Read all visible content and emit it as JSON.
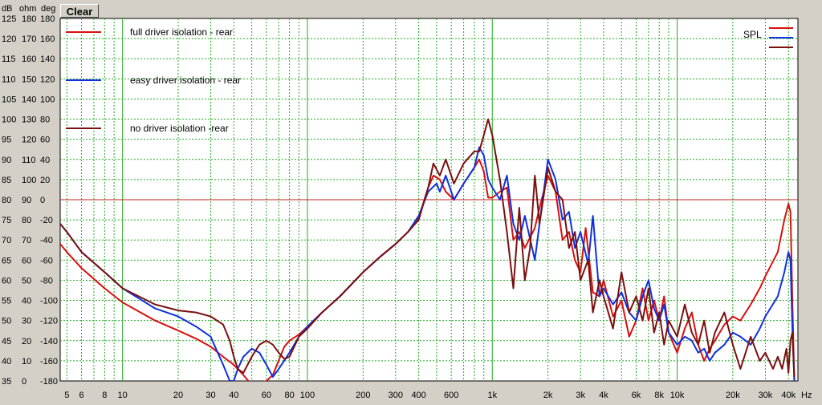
{
  "toolbar": {
    "clear_label": "Clear"
  },
  "chart_data": {
    "type": "line",
    "title": "",
    "xlabel": "Hz",
    "x_scale": "log",
    "xlim": [
      4.6,
      45000
    ],
    "x_tick_labels": [
      {
        "v": 5,
        "t": "5"
      },
      {
        "v": 6,
        "t": "6"
      },
      {
        "v": 8,
        "t": "8"
      },
      {
        "v": 10,
        "t": "10"
      },
      {
        "v": 20,
        "t": "20"
      },
      {
        "v": 30,
        "t": "30"
      },
      {
        "v": 40,
        "t": "40"
      },
      {
        "v": 60,
        "t": "60"
      },
      {
        "v": 80,
        "t": "80"
      },
      {
        "v": 100,
        "t": "100"
      },
      {
        "v": 200,
        "t": "200"
      },
      {
        "v": 300,
        "t": "300"
      },
      {
        "v": 400,
        "t": "400"
      },
      {
        "v": 600,
        "t": "600"
      },
      {
        "v": 1000,
        "t": "1k"
      },
      {
        "v": 2000,
        "t": "2k"
      },
      {
        "v": 3000,
        "t": "3k"
      },
      {
        "v": 4000,
        "t": "4k"
      },
      {
        "v": 6000,
        "t": "6k"
      },
      {
        "v": 8000,
        "t": "8k"
      },
      {
        "v": 10000,
        "t": "10k"
      },
      {
        "v": 20000,
        "t": "20k"
      },
      {
        "v": 30000,
        "t": "30k"
      },
      {
        "v": 40000,
        "t": "40k"
      }
    ],
    "y_axes": {
      "header": [
        "dB",
        "ohm",
        "deg"
      ],
      "db": [
        "125",
        "120",
        "115",
        "110",
        "105",
        "100",
        "95",
        "90",
        "85",
        "80",
        "75",
        "70",
        "65",
        "60",
        "55",
        "50",
        "45",
        "40",
        "35"
      ],
      "ohm": [
        "180",
        "170",
        "160",
        "150",
        "140",
        "130",
        "120",
        "110",
        "100",
        "90",
        "80",
        "70",
        "60",
        "50",
        "40",
        "30",
        "20",
        "10",
        "0"
      ],
      "deg": [
        "180",
        "160",
        "140",
        "120",
        "100",
        "80",
        "60",
        "40",
        "20",
        "0",
        "-20",
        "-40",
        "-60",
        "-80",
        "-100",
        "-120",
        "-140",
        "-160",
        "-180"
      ]
    },
    "ylabel": "dB",
    "ylim": [
      35,
      125
    ],
    "reference_line": 80,
    "grid": true,
    "legend_position": "top-left",
    "series_tag": "SPL",
    "series": [
      {
        "name": "full driver isolation - rear",
        "color": "#d81010",
        "points": [
          [
            4.6,
            69
          ],
          [
            5,
            67
          ],
          [
            6,
            63
          ],
          [
            8,
            58
          ],
          [
            10,
            54.5
          ],
          [
            15,
            50
          ],
          [
            20,
            47.5
          ],
          [
            25,
            45.5
          ],
          [
            30,
            43.5
          ],
          [
            35,
            41
          ],
          [
            40,
            39
          ],
          [
            45,
            36.5
          ],
          [
            50,
            34
          ],
          [
            60,
            35
          ],
          [
            65,
            36.5
          ],
          [
            75,
            43.5
          ],
          [
            80,
            45
          ],
          [
            90,
            46.5
          ],
          [
            100,
            48.5
          ],
          [
            120,
            52
          ],
          [
            150,
            56
          ],
          [
            200,
            62
          ],
          [
            250,
            66
          ],
          [
            300,
            69
          ],
          [
            350,
            72
          ],
          [
            400,
            75.5
          ],
          [
            450,
            83
          ],
          [
            480,
            86
          ],
          [
            520,
            85
          ],
          [
            560,
            82
          ],
          [
            620,
            80
          ],
          [
            700,
            84
          ],
          [
            800,
            88
          ],
          [
            850,
            90
          ],
          [
            900,
            87
          ],
          [
            950,
            80.5
          ],
          [
            1000,
            80.5
          ],
          [
            1100,
            82
          ],
          [
            1200,
            83
          ],
          [
            1300,
            70
          ],
          [
            1400,
            72
          ],
          [
            1500,
            68
          ],
          [
            1700,
            73
          ],
          [
            1800,
            78
          ],
          [
            2000,
            86
          ],
          [
            2200,
            82
          ],
          [
            2400,
            70
          ],
          [
            2600,
            72
          ],
          [
            2800,
            65
          ],
          [
            3000,
            62
          ],
          [
            3200,
            73
          ],
          [
            3500,
            57
          ],
          [
            3800,
            56
          ],
          [
            4000,
            60
          ],
          [
            4500,
            51
          ],
          [
            5000,
            55
          ],
          [
            5500,
            46
          ],
          [
            6000,
            50
          ],
          [
            6500,
            58
          ],
          [
            7000,
            50
          ],
          [
            7500,
            55
          ],
          [
            8000,
            50
          ],
          [
            8500,
            56
          ],
          [
            9000,
            47
          ],
          [
            10000,
            42
          ],
          [
            11000,
            48
          ],
          [
            12000,
            52
          ],
          [
            13000,
            44
          ],
          [
            14000,
            40
          ],
          [
            15000,
            43
          ],
          [
            16000,
            45
          ],
          [
            18000,
            49
          ],
          [
            20000,
            51
          ],
          [
            22000,
            50
          ],
          [
            25000,
            54
          ],
          [
            28000,
            58
          ],
          [
            30000,
            61
          ],
          [
            35000,
            67
          ],
          [
            38000,
            75
          ],
          [
            40000,
            79
          ],
          [
            41000,
            77
          ],
          [
            42000,
            55
          ],
          [
            43000,
            35
          ]
        ]
      },
      {
        "name": "easy driver isolation - rear",
        "color": "#1030e0",
        "points": [
          [
            4.6,
            74
          ],
          [
            5,
            72
          ],
          [
            6,
            67
          ],
          [
            8,
            62
          ],
          [
            10,
            58
          ],
          [
            15,
            53
          ],
          [
            20,
            51
          ],
          [
            25,
            48.5
          ],
          [
            30,
            46
          ],
          [
            32,
            43
          ],
          [
            35,
            39
          ],
          [
            38,
            35
          ],
          [
            40,
            35
          ],
          [
            42,
            38
          ],
          [
            45,
            41
          ],
          [
            50,
            43
          ],
          [
            55,
            42
          ],
          [
            60,
            39
          ],
          [
            65,
            36
          ],
          [
            70,
            38
          ],
          [
            80,
            42
          ],
          [
            90,
            46
          ],
          [
            100,
            48.5
          ],
          [
            120,
            52
          ],
          [
            150,
            56
          ],
          [
            200,
            62
          ],
          [
            250,
            66
          ],
          [
            300,
            69
          ],
          [
            350,
            72
          ],
          [
            400,
            76
          ],
          [
            450,
            82
          ],
          [
            500,
            84
          ],
          [
            520,
            82
          ],
          [
            560,
            86
          ],
          [
            620,
            80
          ],
          [
            700,
            84
          ],
          [
            800,
            88
          ],
          [
            850,
            93
          ],
          [
            900,
            91
          ],
          [
            950,
            85
          ],
          [
            1000,
            83
          ],
          [
            1100,
            80
          ],
          [
            1200,
            86
          ],
          [
            1300,
            74
          ],
          [
            1400,
            70
          ],
          [
            1500,
            76
          ],
          [
            1700,
            65
          ],
          [
            1800,
            74
          ],
          [
            2000,
            90
          ],
          [
            2200,
            85
          ],
          [
            2400,
            75
          ],
          [
            2600,
            77
          ],
          [
            2800,
            68
          ],
          [
            3000,
            72
          ],
          [
            3300,
            64
          ],
          [
            3500,
            76
          ],
          [
            3800,
            56
          ],
          [
            4000,
            58
          ],
          [
            4500,
            54
          ],
          [
            5000,
            57
          ],
          [
            5500,
            52
          ],
          [
            6000,
            50
          ],
          [
            6500,
            56
          ],
          [
            7000,
            60
          ],
          [
            7500,
            53
          ],
          [
            8000,
            50
          ],
          [
            8500,
            54
          ],
          [
            9000,
            47
          ],
          [
            10000,
            44
          ],
          [
            11000,
            46
          ],
          [
            12000,
            45
          ],
          [
            13000,
            42
          ],
          [
            14000,
            43
          ],
          [
            15000,
            40
          ],
          [
            16000,
            42
          ],
          [
            18000,
            44
          ],
          [
            20000,
            47
          ],
          [
            22000,
            46
          ],
          [
            25000,
            44
          ],
          [
            28000,
            48
          ],
          [
            30000,
            51
          ],
          [
            35000,
            56
          ],
          [
            38000,
            62
          ],
          [
            40000,
            67
          ],
          [
            41000,
            65
          ],
          [
            42000,
            48
          ],
          [
            43000,
            35
          ]
        ]
      },
      {
        "name": "no driver isolation -rear",
        "color": "#7a1010",
        "points": [
          [
            4.6,
            74
          ],
          [
            5,
            72
          ],
          [
            6,
            67
          ],
          [
            8,
            62
          ],
          [
            10,
            58
          ],
          [
            15,
            54
          ],
          [
            20,
            52.5
          ],
          [
            25,
            52
          ],
          [
            30,
            51
          ],
          [
            35,
            49
          ],
          [
            38,
            45
          ],
          [
            40,
            41
          ],
          [
            42,
            38
          ],
          [
            45,
            37
          ],
          [
            50,
            41
          ],
          [
            55,
            44
          ],
          [
            60,
            45
          ],
          [
            65,
            44
          ],
          [
            70,
            42
          ],
          [
            75,
            40.5
          ],
          [
            80,
            41
          ],
          [
            90,
            46
          ],
          [
            100,
            48
          ],
          [
            120,
            52
          ],
          [
            150,
            56
          ],
          [
            200,
            62
          ],
          [
            250,
            66
          ],
          [
            300,
            69
          ],
          [
            350,
            72
          ],
          [
            400,
            75
          ],
          [
            450,
            83
          ],
          [
            480,
            89
          ],
          [
            520,
            86
          ],
          [
            560,
            90
          ],
          [
            620,
            84
          ],
          [
            700,
            89
          ],
          [
            800,
            92
          ],
          [
            850,
            92
          ],
          [
            900,
            96
          ],
          [
            950,
            100
          ],
          [
            1000,
            96
          ],
          [
            1100,
            85
          ],
          [
            1200,
            72
          ],
          [
            1300,
            58
          ],
          [
            1400,
            78
          ],
          [
            1500,
            60
          ],
          [
            1600,
            68
          ],
          [
            1700,
            86
          ],
          [
            1800,
            74
          ],
          [
            2000,
            88
          ],
          [
            2200,
            82
          ],
          [
            2400,
            80
          ],
          [
            2600,
            68
          ],
          [
            2800,
            72
          ],
          [
            3000,
            60
          ],
          [
            3300,
            65
          ],
          [
            3500,
            52
          ],
          [
            3800,
            60
          ],
          [
            4000,
            56
          ],
          [
            4500,
            48
          ],
          [
            5000,
            62
          ],
          [
            5500,
            52
          ],
          [
            6000,
            56
          ],
          [
            6500,
            50
          ],
          [
            7000,
            58
          ],
          [
            7500,
            47
          ],
          [
            8000,
            52
          ],
          [
            8500,
            44
          ],
          [
            9000,
            50
          ],
          [
            10000,
            46
          ],
          [
            11000,
            54
          ],
          [
            12000,
            47
          ],
          [
            13000,
            44
          ],
          [
            14000,
            50
          ],
          [
            15000,
            42
          ],
          [
            16000,
            47
          ],
          [
            18000,
            52
          ],
          [
            20000,
            44
          ],
          [
            22000,
            38
          ],
          [
            25000,
            46
          ],
          [
            28000,
            40
          ],
          [
            30000,
            42
          ],
          [
            33000,
            38
          ],
          [
            35000,
            41
          ],
          [
            37000,
            38
          ],
          [
            39000,
            43
          ],
          [
            40000,
            37
          ],
          [
            41000,
            45
          ],
          [
            42000,
            47
          ],
          [
            43000,
            36
          ]
        ]
      }
    ]
  }
}
